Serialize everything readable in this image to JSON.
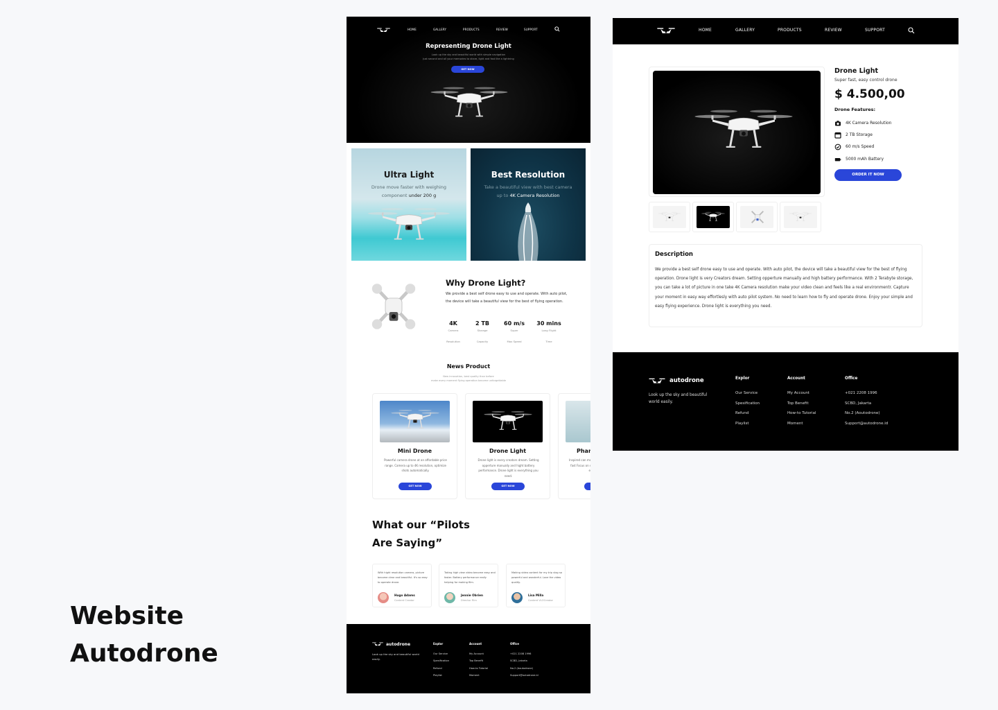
{
  "showcase": {
    "title_line1": "Website",
    "title_line2": "Autodrone"
  },
  "landing": {
    "nav": {
      "home": "HOME",
      "gallery": "GALLERY",
      "products": "PRODUCTS",
      "review": "REVIEW",
      "support": "SUPPORT"
    },
    "hero": {
      "title": "Representing Drone Light",
      "sub_line1": "Look up the sky and beautiful world with simple navigation",
      "sub_line2": "Just second and all your memories to share, light and fast like a lightning",
      "cta": "GET NOW"
    },
    "features": [
      {
        "title": "Ultra Light",
        "text_pre": "Drone move faster with weighing component ",
        "text_hl": "under 200 g"
      },
      {
        "title": "Best Resolution",
        "text_pre": "Take a beautiful view with best camera up to ",
        "text_hl": "4K Camera Resolution"
      }
    ],
    "why": {
      "title": "Why Drone Light?",
      "text": "We provide a best self drone easy to use and operate. With auto pilot, the device will take a beautiful view for the best of flying operation.",
      "stats": [
        {
          "value": "4K",
          "l1": "Camera",
          "l2": "Resolution"
        },
        {
          "value": "2 TB",
          "l1": "Storage",
          "l2": "Capacity"
        },
        {
          "value": "60 m/s",
          "l1": "Super",
          "l2": "Max Speed"
        },
        {
          "value": "30 mins",
          "l1": "Long Flight",
          "l2": "Time"
        }
      ]
    },
    "news": {
      "title": "News Product",
      "sub_line1": "New innovation, best quality than before",
      "sub_line2": "make every moment flying operation become unforgettable",
      "products": [
        {
          "name": "Mini Drone",
          "text": "Powerful camera drone at an affordable price range. Camera up to 4K resolution, optimize shots automatically.",
          "cta": "GET NOW"
        },
        {
          "name": "Drone Light",
          "text": "Drone light is every creators dream. Setting opperture manually and hight battery performance. Drone light is everything you need.",
          "cta": "GET NOW"
        },
        {
          "name": "Phan",
          "text": "Inspired can move fast Focus on spe envi",
          "cta": ""
        }
      ]
    },
    "pilots": {
      "title_line1": "What our “Pilots",
      "title_line2": "Are Saying”"
    },
    "testimonials": [
      {
        "text": "With hight resolution camera, picture become clear and beautiful. It's so easy to operate drone.",
        "name": "Hugo Adams",
        "role": "Content Creator"
      },
      {
        "text": "Taking high view video become easy and faster. Battery performance really helping for making film.",
        "name": "Jennie Obrien",
        "role": "Director Film"
      },
      {
        "text": "Making video content for my trip vlog so powerful and wonderful. Love the video quality.",
        "name": "Lisa Milla",
        "role": "Content VLOCreator"
      }
    ],
    "footer": {
      "brand": "autodrone",
      "tagline": "Look up the sky and beautiful world easily.",
      "cols": [
        {
          "title": "Explor",
          "items": [
            "Our Service",
            "Spesification",
            "Refund",
            "Playlist"
          ]
        },
        {
          "title": "Account",
          "items": [
            "My Account",
            "Top Benefit",
            "How-to Tutorial",
            "Moment"
          ]
        },
        {
          "title": "Office",
          "items": [
            "+021 2208 1996",
            "SCBD, Jakarta",
            "No.2 (Aoutodrone)",
            "Support@autodrone.id"
          ]
        }
      ]
    }
  },
  "detail": {
    "nav": {
      "home": "HOME",
      "gallery": "GALLERY",
      "products": "PRODUCTS",
      "review": "REVIEW",
      "support": "SUPPORT"
    },
    "product": {
      "name": "Drone Light",
      "subtitle": "Super fast, easy control drone",
      "price": "$ 4.500,00",
      "features_title": "Drone Features:",
      "features": [
        {
          "icon": "camera-icon",
          "label": "4K Camera Resolution"
        },
        {
          "icon": "storage-icon",
          "label": "2 TB Storage"
        },
        {
          "icon": "speed-icon",
          "label": "60 m/s Speed"
        },
        {
          "icon": "battery-icon",
          "label": "5000 mAh Battery"
        }
      ],
      "order": "ORDER IT NOW"
    },
    "description": {
      "title": "Description",
      "text": "We provide a best self drone easy to use and operate. With auto pilot, the device will take a beautiful view for the best of flying operation. Drone light is very Creators dream. Setting opperture manually and high battery performance. With 2 Terabyte storage, you can take a lot of picture in one take 4K Camera resolution make your video clean and feels like a real environmentr. Capture your moment in easy way effortlesly with auto pilot system. No need to learn how to fly and operate drone. Enjoy your simple and easy flying experience. Drone light is everything you need."
    },
    "footer": {
      "brand": "autodrone",
      "tagline": "Look up the sky and beautiful world easily.",
      "cols": [
        {
          "title": "Explor",
          "items": [
            "Our Service",
            "Spesification",
            "Refund",
            "Playlist"
          ]
        },
        {
          "title": "Account",
          "items": [
            "My Account",
            "Top Benefit",
            "How-to Tutorial",
            "Moment"
          ]
        },
        {
          "title": "Office",
          "items": [
            "+021 2208 1996",
            "SCBD, Jakarta",
            "No.2 (Aoutodrone)",
            "Support@autodrone.id"
          ]
        }
      ]
    }
  },
  "colors": {
    "accent": "#2a46d9",
    "dark": "#000000",
    "background": "#f7f8fa"
  }
}
